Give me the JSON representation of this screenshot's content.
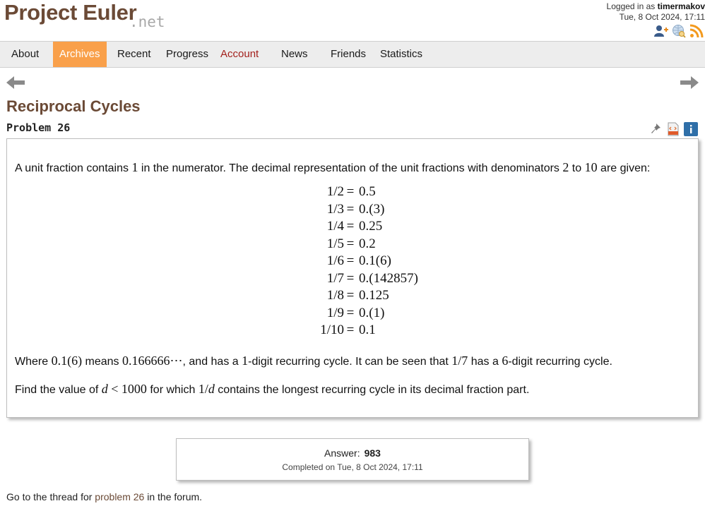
{
  "header": {
    "logo_main": "Project Euler",
    "logo_suffix": ".net",
    "logged_in_prefix": "Logged in as",
    "username": "timermakov",
    "datetime": "Tue, 8 Oct 2024, 17:11",
    "icons": [
      "add-friend-icon",
      "globe-search-icon",
      "rss-feed-icon"
    ]
  },
  "nav": {
    "items": [
      {
        "label": "About"
      },
      {
        "label": "Archives"
      },
      {
        "label": "Recent"
      },
      {
        "label": "Progress"
      },
      {
        "label": "Account"
      },
      {
        "label": "News"
      },
      {
        "label": "Friends"
      },
      {
        "label": "Statistics"
      }
    ],
    "active": "Archives",
    "active_color": "#f9a04a",
    "account_color": "#a3201c"
  },
  "problem": {
    "title": "Reciprocal Cycles",
    "number_label": "Problem 26",
    "intro_text_1": "A unit fraction contains ",
    "intro_one": "1",
    "intro_text_2": " in the numerator. The decimal representation of the unit fractions with denominators ",
    "intro_two": "2",
    "intro_text_3": " to ",
    "intro_ten": "10",
    "intro_text_4": " are given:",
    "equations": [
      {
        "lhs": "1/2",
        "rhs": "0.5"
      },
      {
        "lhs": "1/3",
        "rhs": "0.(3)"
      },
      {
        "lhs": "1/4",
        "rhs": "0.25"
      },
      {
        "lhs": "1/5",
        "rhs": "0.2"
      },
      {
        "lhs": "1/6",
        "rhs": "0.1(6)"
      },
      {
        "lhs": "1/7",
        "rhs": "0.(142857)"
      },
      {
        "lhs": "1/8",
        "rhs": "0.125"
      },
      {
        "lhs": "1/9",
        "rhs": "0.(1)"
      },
      {
        "lhs": "1/10",
        "rhs": "0.1"
      }
    ],
    "equals_sign": "=",
    "where_1": "Where ",
    "where_m1": "0.1(6)",
    "where_2": " means ",
    "where_m2": "0.166666⋯",
    "where_3": ", and has a ",
    "where_m3": "1",
    "where_4": "-digit recurring cycle. It can be seen that ",
    "where_m4": "1/7",
    "where_5": " has a ",
    "where_m5": "6",
    "where_6": "-digit recurring cycle.",
    "find_1": "Find the value of ",
    "find_d": "d",
    "find_lt": " < 1000",
    "find_2": " for which ",
    "find_m": "1/",
    "find_d2": "d",
    "find_3": " contains the longest recurring cycle in its decimal fraction part."
  },
  "answer": {
    "label": "Answer:",
    "value": "983",
    "completed": "Completed on Tue, 8 Oct 2024, 17:11"
  },
  "footer": {
    "text_before": "Go to the thread for ",
    "link": "problem 26",
    "text_after": " in the forum."
  }
}
